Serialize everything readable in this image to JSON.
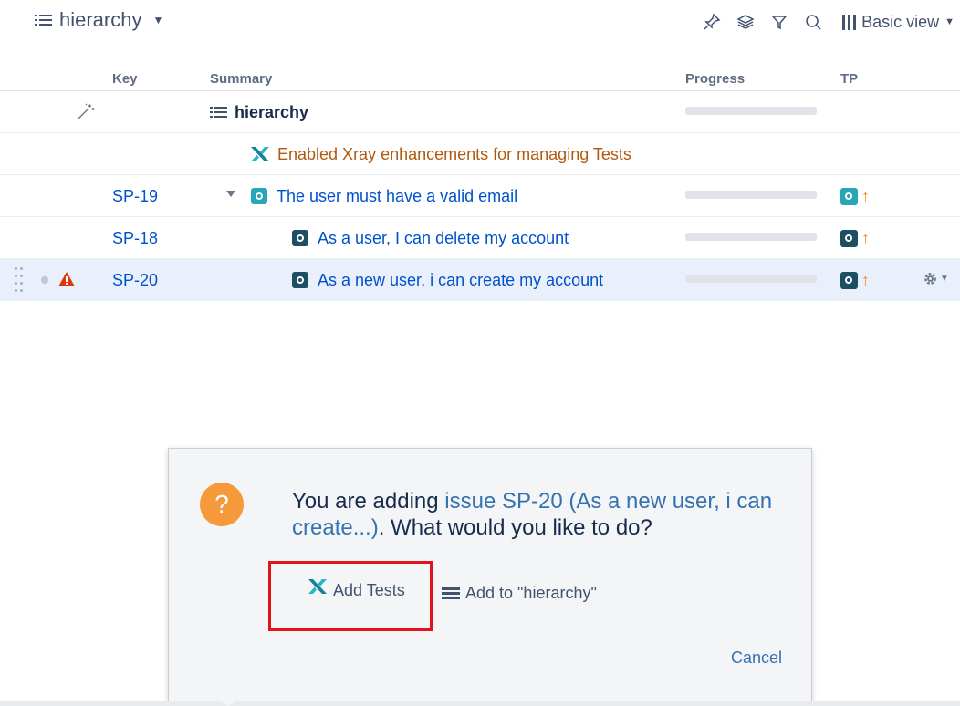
{
  "header": {
    "title": "hierarchy",
    "view_label": "Basic view",
    "tools": [
      "pin-icon",
      "layers-icon",
      "filter-icon",
      "search-icon"
    ]
  },
  "columns": {
    "key": "Key",
    "summary": "Summary",
    "progress": "Progress",
    "tp": "TP"
  },
  "rows": [
    {
      "key": "",
      "summary": "hierarchy",
      "type": "root"
    },
    {
      "key": "",
      "summary": "Enabled Xray enhancements for managing Tests",
      "type": "generator"
    },
    {
      "key": "SP-19",
      "summary": "The user must have a valid email",
      "type": "issue",
      "expanded": true
    },
    {
      "key": "SP-18",
      "summary": "As a user, I can delete my account",
      "type": "issue"
    },
    {
      "key": "SP-20",
      "summary": "As a new user, i can create my account",
      "type": "issue",
      "selected": true
    }
  ],
  "dialog": {
    "message_prefix": "You are adding ",
    "message_link": "issue SP-20 (As a new user, i can create...)",
    "message_suffix": ". What would you like to do?",
    "add_tests_label": "Add Tests",
    "add_to_label": "Add to \"hierarchy\"",
    "cancel_label": "Cancel",
    "icon_text": "?"
  },
  "colors": {
    "link": "#0052cc",
    "xray_orange": "#b05a0e",
    "priority_arrow": "#f08b25",
    "selected_row": "#e9f0fb",
    "question_icon": "#f6993a",
    "highlight_border": "#e3121b"
  }
}
